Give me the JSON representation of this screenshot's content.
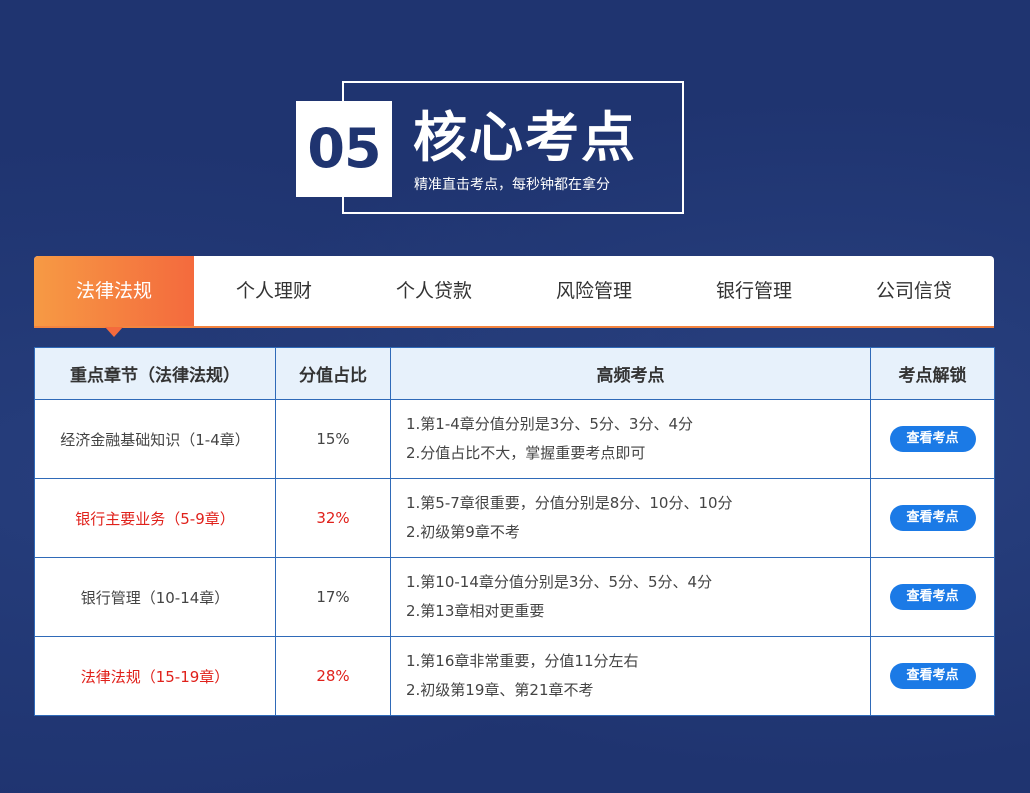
{
  "header": {
    "number": "05",
    "title": "核心考点",
    "subtitle": "精准直击考点，每秒钟都在拿分"
  },
  "tabs": [
    {
      "label": "法律法规",
      "active": true
    },
    {
      "label": "个人理财",
      "active": false
    },
    {
      "label": "个人贷款",
      "active": false
    },
    {
      "label": "风险管理",
      "active": false
    },
    {
      "label": "银行管理",
      "active": false
    },
    {
      "label": "公司信贷",
      "active": false
    }
  ],
  "table": {
    "headers": [
      "重点章节（法律法规）",
      "分值占比",
      "高频考点",
      "考点解锁"
    ],
    "rows": [
      {
        "chapter": "经济金融基础知识（1-4章）",
        "percent": "15%",
        "highlight": false,
        "points": [
          "1.第1-4章分值分别是3分、5分、3分、4分",
          "2.分值占比不大，掌握重要考点即可"
        ],
        "button": "查看考点"
      },
      {
        "chapter": "银行主要业务（5-9章）",
        "percent": "32%",
        "highlight": true,
        "points": [
          "1.第5-7章很重要，分值分别是8分、10分、10分",
          "2.初级第9章不考"
        ],
        "button": "查看考点"
      },
      {
        "chapter": "银行管理（10-14章）",
        "percent": "17%",
        "highlight": false,
        "points": [
          "1.第10-14章分值分别是3分、5分、5分、4分",
          "2.第13章相对更重要"
        ],
        "button": "查看考点"
      },
      {
        "chapter": "法律法规（15-19章）",
        "percent": "28%",
        "highlight": true,
        "points": [
          "1.第16章非常重要，分值11分左右",
          "2.初级第19章、第21章不考"
        ],
        "button": "查看考点"
      }
    ]
  },
  "colors": {
    "background": "#1f3470",
    "accent_orange": "#f46a3d",
    "button_blue": "#1b7ae6",
    "highlight_red": "#e0211b"
  }
}
